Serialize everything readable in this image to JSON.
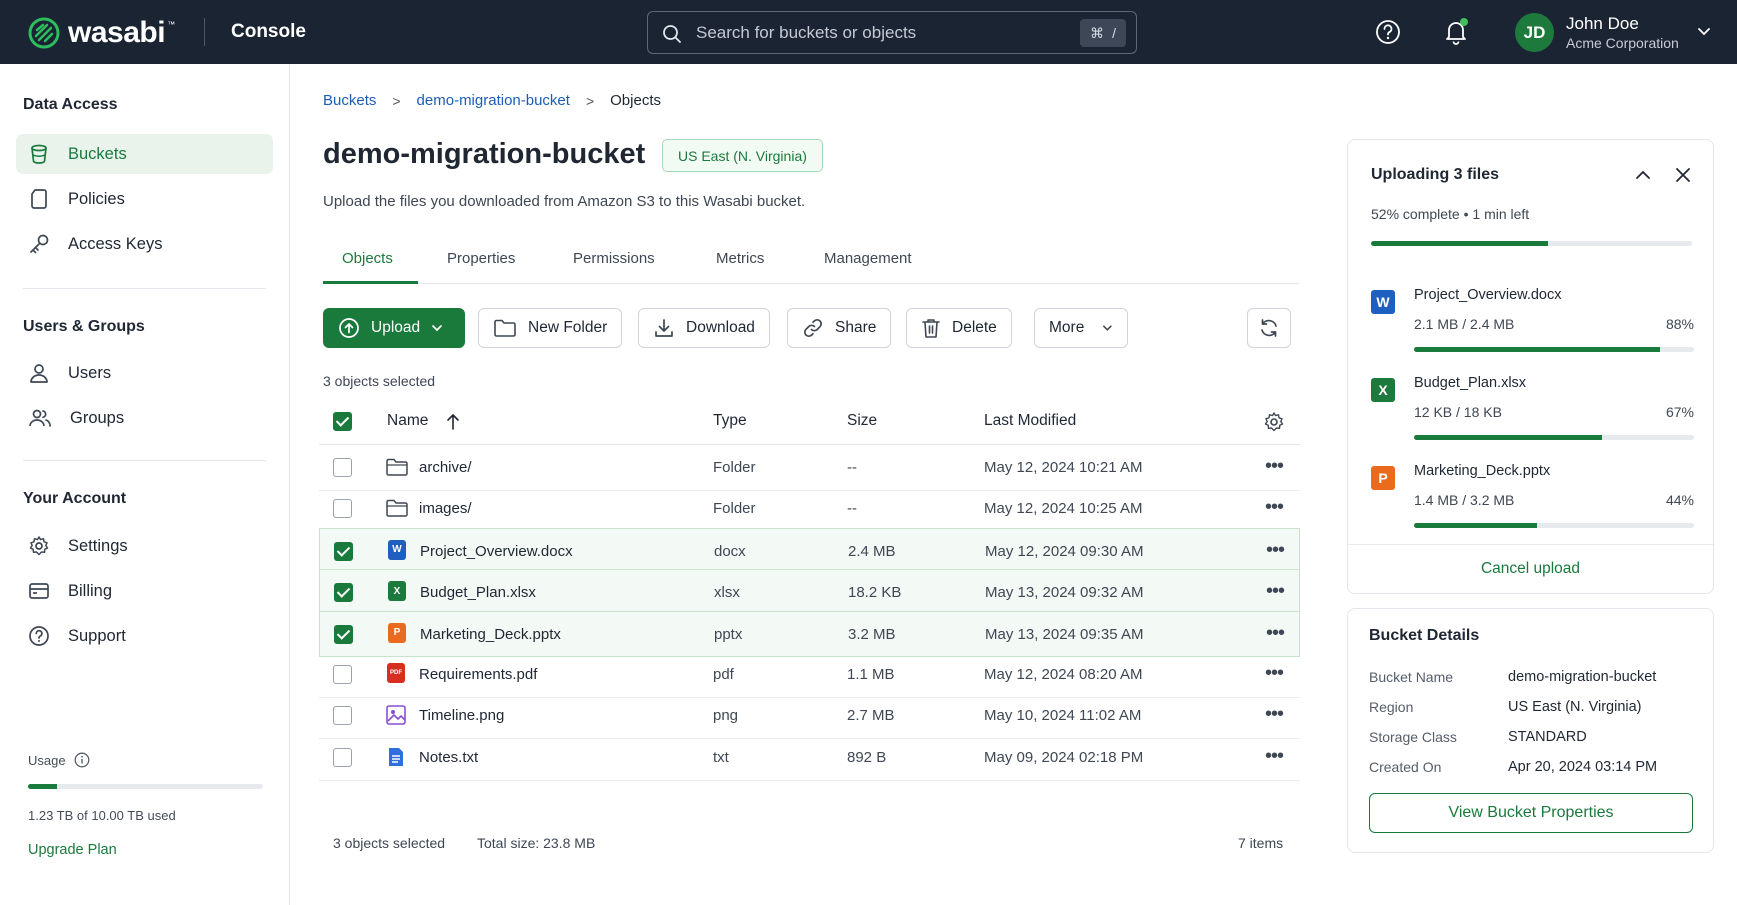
{
  "app": {
    "logo_text": "wasabi",
    "logo_tm": "™",
    "console_label": "Console"
  },
  "search": {
    "placeholder": "Search for buckets or objects",
    "shortcut_key1": "⌘",
    "shortcut_key2": "/"
  },
  "user": {
    "initials": "JD",
    "name": "John Doe",
    "org": "Acme Corporation"
  },
  "sidebar": {
    "data_access_title": "Data Access",
    "data_access_items": [
      {
        "label": "Buckets",
        "icon": "bucket-icon",
        "active": true
      },
      {
        "label": "Policies",
        "icon": "document-icon",
        "active": false
      },
      {
        "label": "Access Keys",
        "icon": "key-icon",
        "active": false
      }
    ],
    "users_title": "Users & Groups",
    "users_items": [
      {
        "label": "Users",
        "icon": "user-icon"
      },
      {
        "label": "Groups",
        "icon": "group-icon"
      }
    ],
    "account_title": "Your Account",
    "account_items": [
      {
        "label": "Settings",
        "icon": "gear-icon"
      },
      {
        "label": "Billing",
        "icon": "billing-icon"
      },
      {
        "label": "Support",
        "icon": "help-icon"
      }
    ],
    "usage_label": "Usage",
    "usage_fraction": 0.123,
    "usage_text": "1.23 TB of 10.00 TB used",
    "upgrade_label": "Upgrade Plan"
  },
  "breadcrumb": {
    "items": [
      "Buckets",
      "demo-migration-bucket",
      "Objects"
    ],
    "separator": ">"
  },
  "page": {
    "title": "demo-migration-bucket",
    "region_badge": "US East (N. Virginia)",
    "subtitle": "Upload the files you downloaded from Amazon S3 to this Wasabi bucket."
  },
  "tabs": [
    "Objects",
    "Properties",
    "Permissions",
    "Metrics",
    "Management"
  ],
  "toolbar": {
    "upload": "Upload",
    "new_folder": "New Folder",
    "download": "Download",
    "share": "Share",
    "delete": "Delete",
    "more": "More"
  },
  "selection_text": "3 objects selected",
  "table": {
    "columns": [
      "Name",
      "Type",
      "Size",
      "Last Modified"
    ],
    "rows": [
      {
        "name": "archive/",
        "kind": "folder",
        "type": "Folder",
        "size": "--",
        "modified": "May 12, 2024 10:21 AM",
        "checked": false
      },
      {
        "name": "images/",
        "kind": "folder",
        "type": "Folder",
        "size": "--",
        "modified": "May 12, 2024 10:25 AM",
        "checked": false
      },
      {
        "name": "Project_Overview.docx",
        "kind": "docx",
        "type": "docx",
        "size": "2.4 MB",
        "modified": "May 12, 2024 09:30 AM",
        "checked": true
      },
      {
        "name": "Budget_Plan.xlsx",
        "kind": "xlsx",
        "type": "xlsx",
        "size": "18.2 KB",
        "modified": "May 13, 2024 09:32 AM",
        "checked": true
      },
      {
        "name": "Marketing_Deck.pptx",
        "kind": "pptx",
        "type": "pptx",
        "size": "3.2 MB",
        "modified": "May 13, 2024 09:35 AM",
        "checked": true
      },
      {
        "name": "Requirements.pdf",
        "kind": "pdf",
        "type": "pdf",
        "size": "1.1 MB",
        "modified": "May 12, 2024 08:20 AM",
        "checked": false
      },
      {
        "name": "Timeline.png",
        "kind": "png",
        "type": "png",
        "size": "2.7 MB",
        "modified": "May 10, 2024 11:02 AM",
        "checked": false
      },
      {
        "name": "Notes.txt",
        "kind": "txt",
        "type": "txt",
        "size": "892 B",
        "modified": "May 09, 2024 02:18 PM",
        "checked": false
      }
    ],
    "kebab": "•••"
  },
  "footer": {
    "selected": "3 objects selected",
    "total": "Total size: 23.8 MB",
    "count": "7 items"
  },
  "upload_panel": {
    "title": "Uploading 3 files",
    "progress_text": "52% complete • 1 min left",
    "progress_fraction": 0.55,
    "files": [
      {
        "badge": "W",
        "color": "#1f5fbf",
        "name": "Project_Overview.docx",
        "size": "2.1 MB / 2.4 MB",
        "pct": "88%",
        "fraction": 0.88
      },
      {
        "badge": "X",
        "color": "#1e7a3c",
        "name": "Budget_Plan.xlsx",
        "size": "12 KB / 18 KB",
        "pct": "67%",
        "fraction": 0.67
      },
      {
        "badge": "P",
        "color": "#ea6a1e",
        "name": "Marketing_Deck.pptx",
        "size": "1.4 MB / 3.2 MB",
        "pct": "44%",
        "fraction": 0.44
      }
    ],
    "cancel_label": "Cancel upload"
  },
  "bucket_details": {
    "title": "Bucket Details",
    "fields": [
      {
        "key": "Bucket Name",
        "value": "demo-migration-bucket"
      },
      {
        "key": "Region",
        "value": "US East (N. Virginia)"
      },
      {
        "key": "Storage Class",
        "value": "STANDARD"
      },
      {
        "key": "Created On",
        "value": "Apr 20, 2024 03:14 PM"
      }
    ],
    "button_label": "View Bucket Properties"
  },
  "colors": {
    "topbar": "#1b2433",
    "accent": "#1a7a3c",
    "link": "#1a5fb4"
  }
}
